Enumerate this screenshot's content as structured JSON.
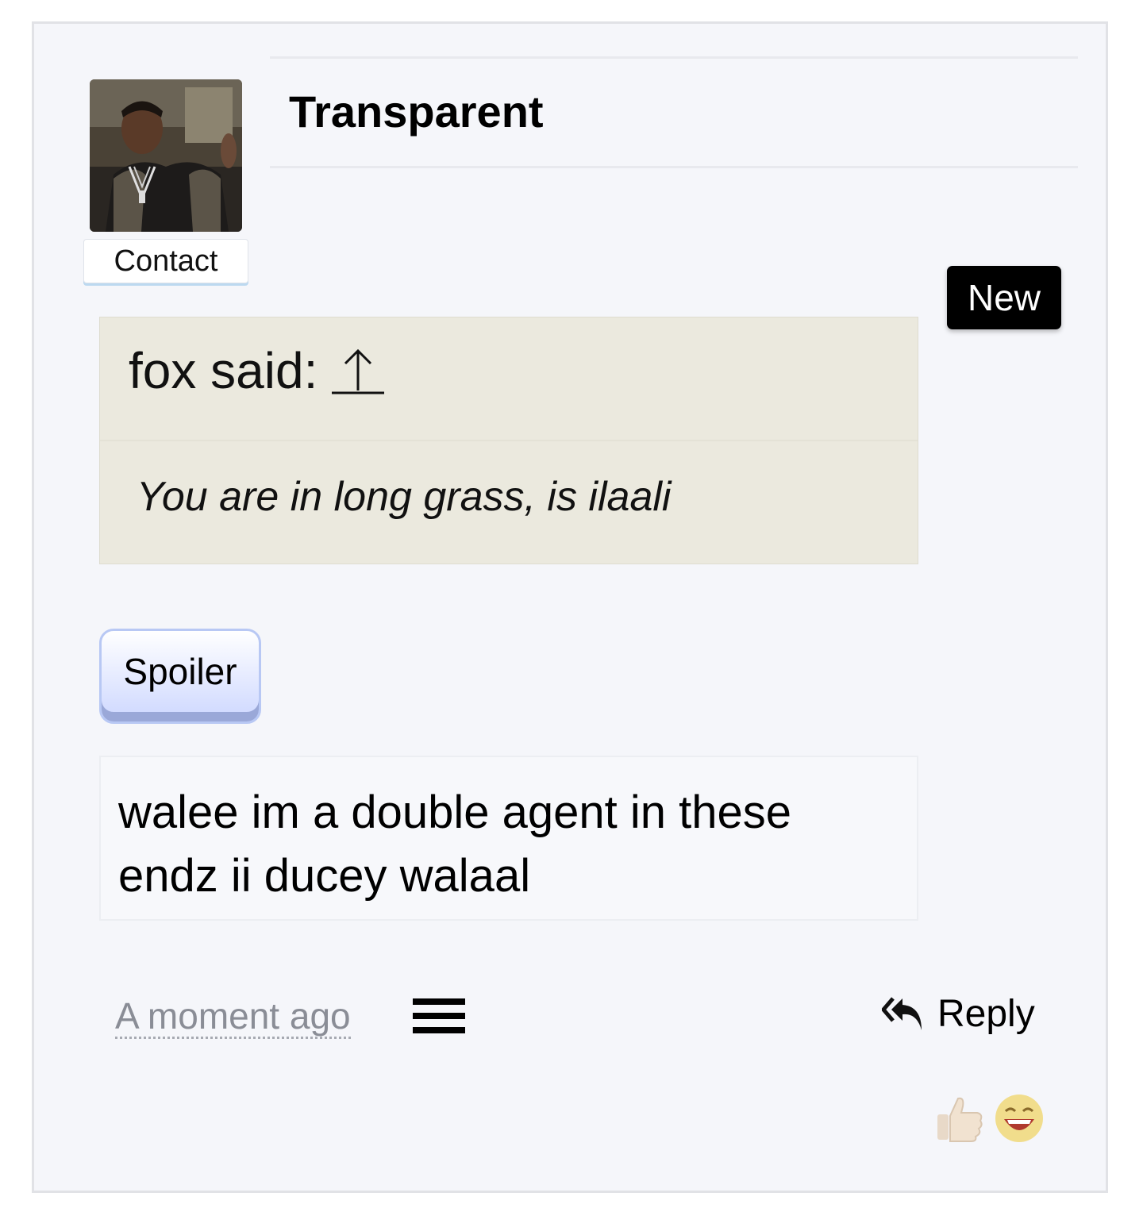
{
  "post": {
    "title": "Transparent",
    "contact_label": "Contact",
    "new_badge": "New",
    "quote": {
      "author_line": "fox said:",
      "text": "You are in long grass, is ilaali"
    },
    "spoiler_label": "Spoiler",
    "message": "walee im a double agent in these endz ii ducey walaal",
    "timestamp": "A moment ago",
    "reply_label": "Reply"
  },
  "icons": {
    "quote_link": "up-arrow-icon",
    "menu": "hamburger-menu-icon",
    "reply": "reply-all-icon",
    "reactions": [
      "thumbs-up-icon",
      "laughing-face-icon"
    ]
  },
  "colors": {
    "card_background": "#f5f6fa",
    "quote_background": "#ebe9de",
    "badge_background": "#000000",
    "spoiler_gradient": "#cdd7ff",
    "timestamp": "#8a8d96"
  }
}
